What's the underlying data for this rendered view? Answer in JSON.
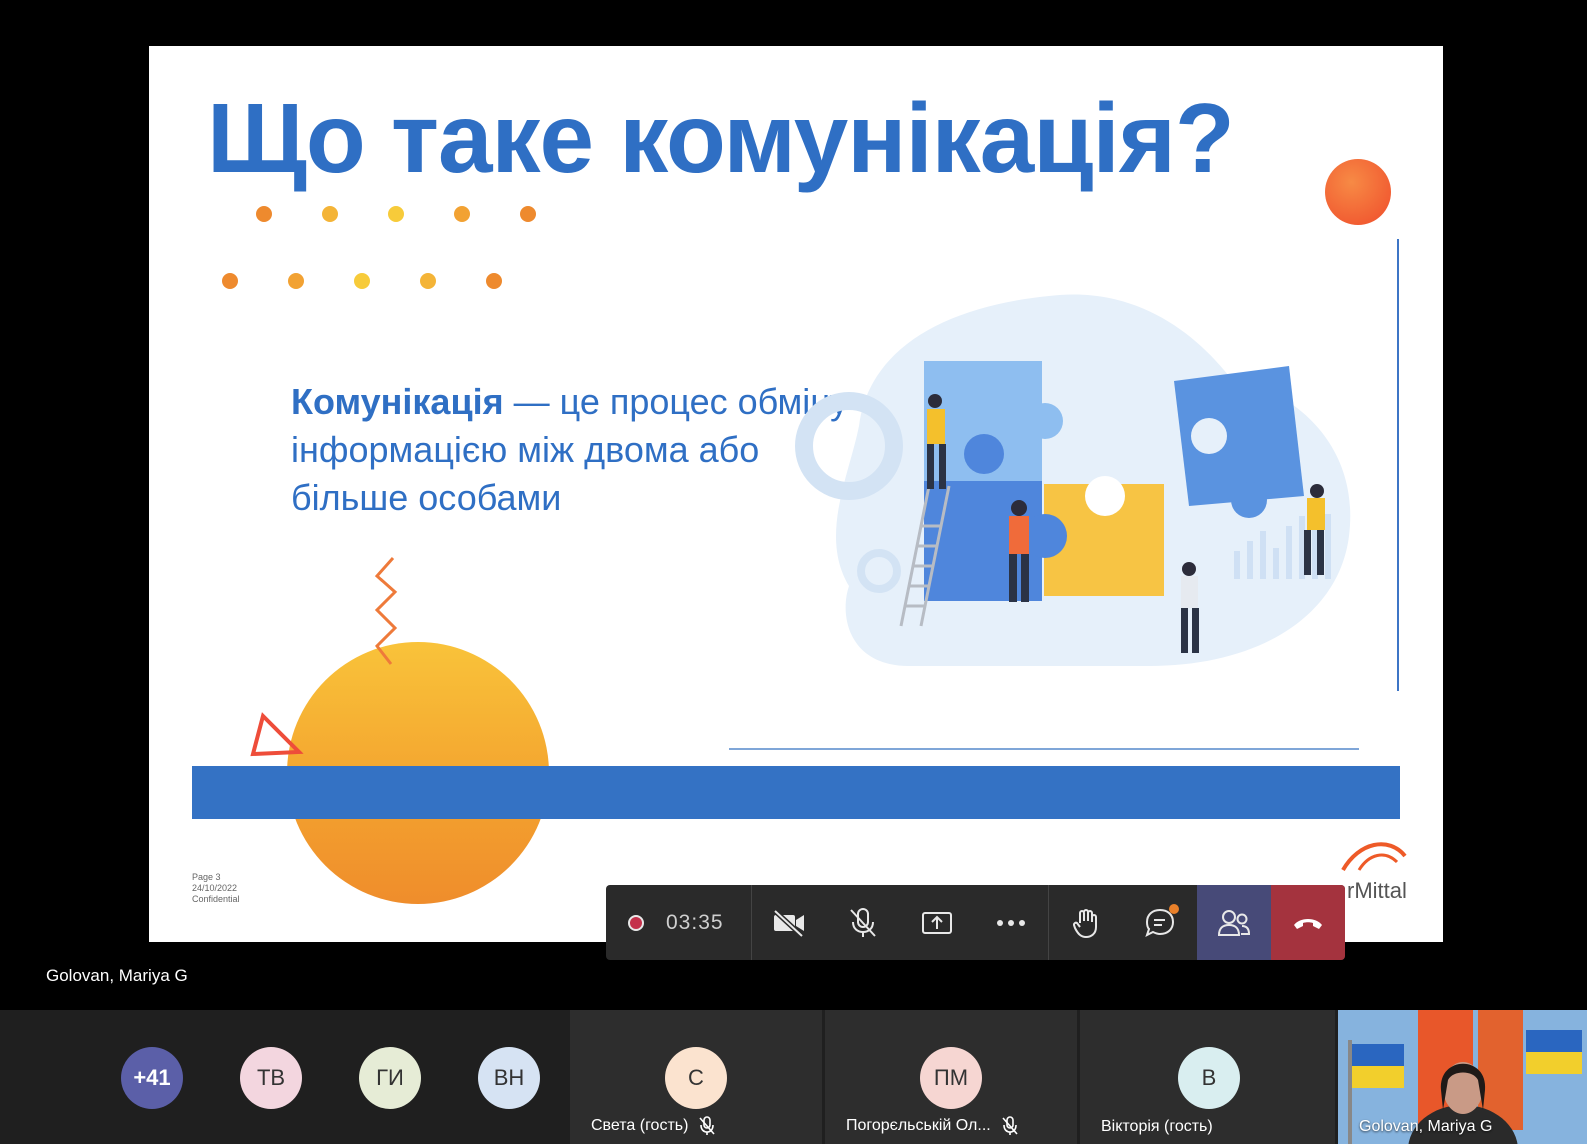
{
  "slide": {
    "title": "Що таке комунікація?",
    "definition_term": "Комунікація",
    "definition_rest": " — це процес обміну інформацією між двома або більше особами",
    "footer": {
      "page": "Page 3",
      "date": "24/10/2022",
      "classification": "Confidential"
    },
    "logo_text": "rMittal",
    "colors": {
      "title": "#2f6fc4",
      "bar": "#3472c4",
      "accent_orange": "#ef4c2b"
    }
  },
  "toolbar": {
    "recording_icon": "record-icon",
    "timer": "03:35",
    "buttons": [
      {
        "name": "camera-off-icon"
      },
      {
        "name": "mic-off-icon"
      },
      {
        "name": "share-screen-icon"
      },
      {
        "name": "more-icon"
      },
      {
        "name": "raise-hand-icon"
      },
      {
        "name": "chat-icon"
      },
      {
        "name": "participants-icon"
      },
      {
        "name": "hang-up-icon"
      }
    ],
    "colors": {
      "participants_bg": "#474a78",
      "leave_bg": "#a4333e"
    }
  },
  "presenter": {
    "name": "Golovan, Mariya G"
  },
  "participants": {
    "overflow": [
      {
        "initials": "+41",
        "color": "#5b5fa8"
      },
      {
        "initials": "ТВ",
        "color": "#f3d6df"
      },
      {
        "initials": "ГИ",
        "color": "#e6ecd6"
      },
      {
        "initials": "ВН",
        "color": "#d6e3f3"
      }
    ],
    "tiles": [
      {
        "initials": "С",
        "name": "Света (гость)",
        "color": "#fbe3cf"
      },
      {
        "initials": "ПМ",
        "name": "Погорєльській Ол...",
        "color": "#f6d6d2"
      },
      {
        "initials": "В",
        "name": "Вікторія (гость)",
        "color": "#d9eef0"
      }
    ],
    "self_video": {
      "name": "Golovan, Mariya G"
    }
  }
}
